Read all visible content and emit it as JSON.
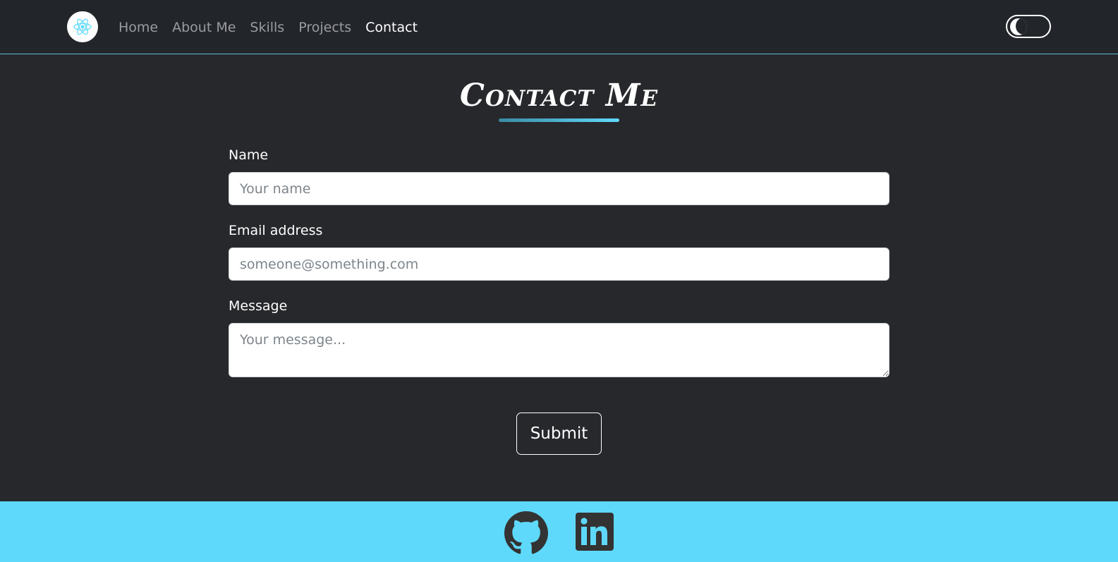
{
  "navbar": {
    "logo_icon": "react-atom-icon",
    "links": [
      {
        "label": "Home",
        "active": false
      },
      {
        "label": "About Me",
        "active": false
      },
      {
        "label": "Skills",
        "active": false
      },
      {
        "label": "Projects",
        "active": false
      },
      {
        "label": "Contact",
        "active": true
      }
    ],
    "theme_toggle_icon": "moon-icon"
  },
  "contact": {
    "title": "Contact Me",
    "name_label": "Name",
    "name_placeholder": "Your name",
    "email_label": "Email address",
    "email_placeholder": "someone@something.com",
    "message_label": "Message",
    "message_placeholder": "Your message...",
    "submit_label": "Submit"
  },
  "footer": {
    "links": [
      {
        "icon": "github-icon"
      },
      {
        "icon": "linkedin-icon"
      }
    ]
  },
  "colors": {
    "navbar_bg": "#22252a",
    "page_bg": "#27282b",
    "accent": "#61dafb",
    "footer_bg": "#5fd9fb",
    "footer_icon": "#333333"
  }
}
